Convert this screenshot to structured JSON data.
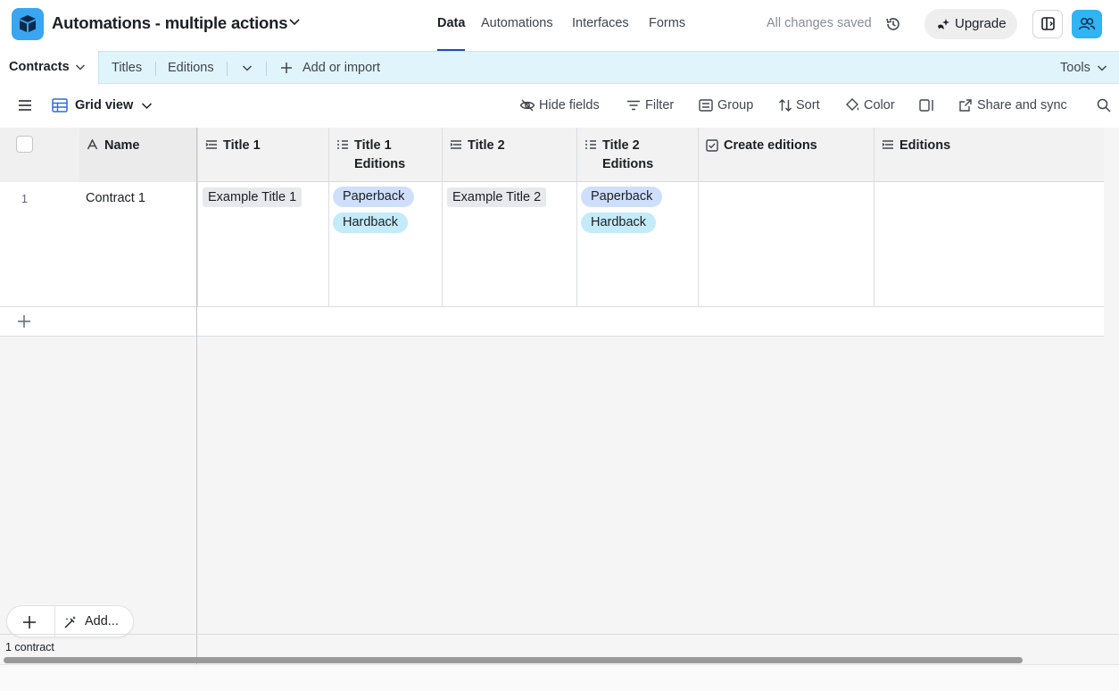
{
  "header": {
    "base_title": "Automations - multiple actions",
    "nav": [
      "Data",
      "Automations",
      "Interfaces",
      "Forms"
    ],
    "active_nav": "Data",
    "status": "All changes saved",
    "upgrade_label": "Upgrade"
  },
  "tables": {
    "active": "Contracts",
    "others": [
      "Titles",
      "Editions"
    ],
    "add_label": "Add or import",
    "tools_label": "Tools"
  },
  "viewbar": {
    "view_name": "Grid view",
    "hide_fields": "Hide fields",
    "filter": "Filter",
    "group": "Group",
    "sort": "Sort",
    "color": "Color",
    "share": "Share and sync"
  },
  "grid": {
    "columns": [
      {
        "name": "Name"
      },
      {
        "name": "Title 1"
      },
      {
        "name": "Title 1 Editions"
      },
      {
        "name": "Title 2"
      },
      {
        "name": "Title 2 Editions"
      },
      {
        "name": "Create editions"
      },
      {
        "name": "Editions"
      }
    ],
    "rows": [
      {
        "num": "1",
        "name": "Contract 1",
        "title1": "Example Title 1",
        "title1_editions": [
          "Paperback",
          "Hardback"
        ],
        "title2": "Example Title 2",
        "title2_editions": [
          "Paperback",
          "Hardback"
        ]
      }
    ],
    "add_label": "Add...",
    "record_count": "1 contract"
  },
  "colors": {
    "accent": "#30b4f2",
    "table_bar": "#e0f4fb",
    "pill_blue": "#cfdffb",
    "pill_cyan": "#c3ebf9"
  }
}
